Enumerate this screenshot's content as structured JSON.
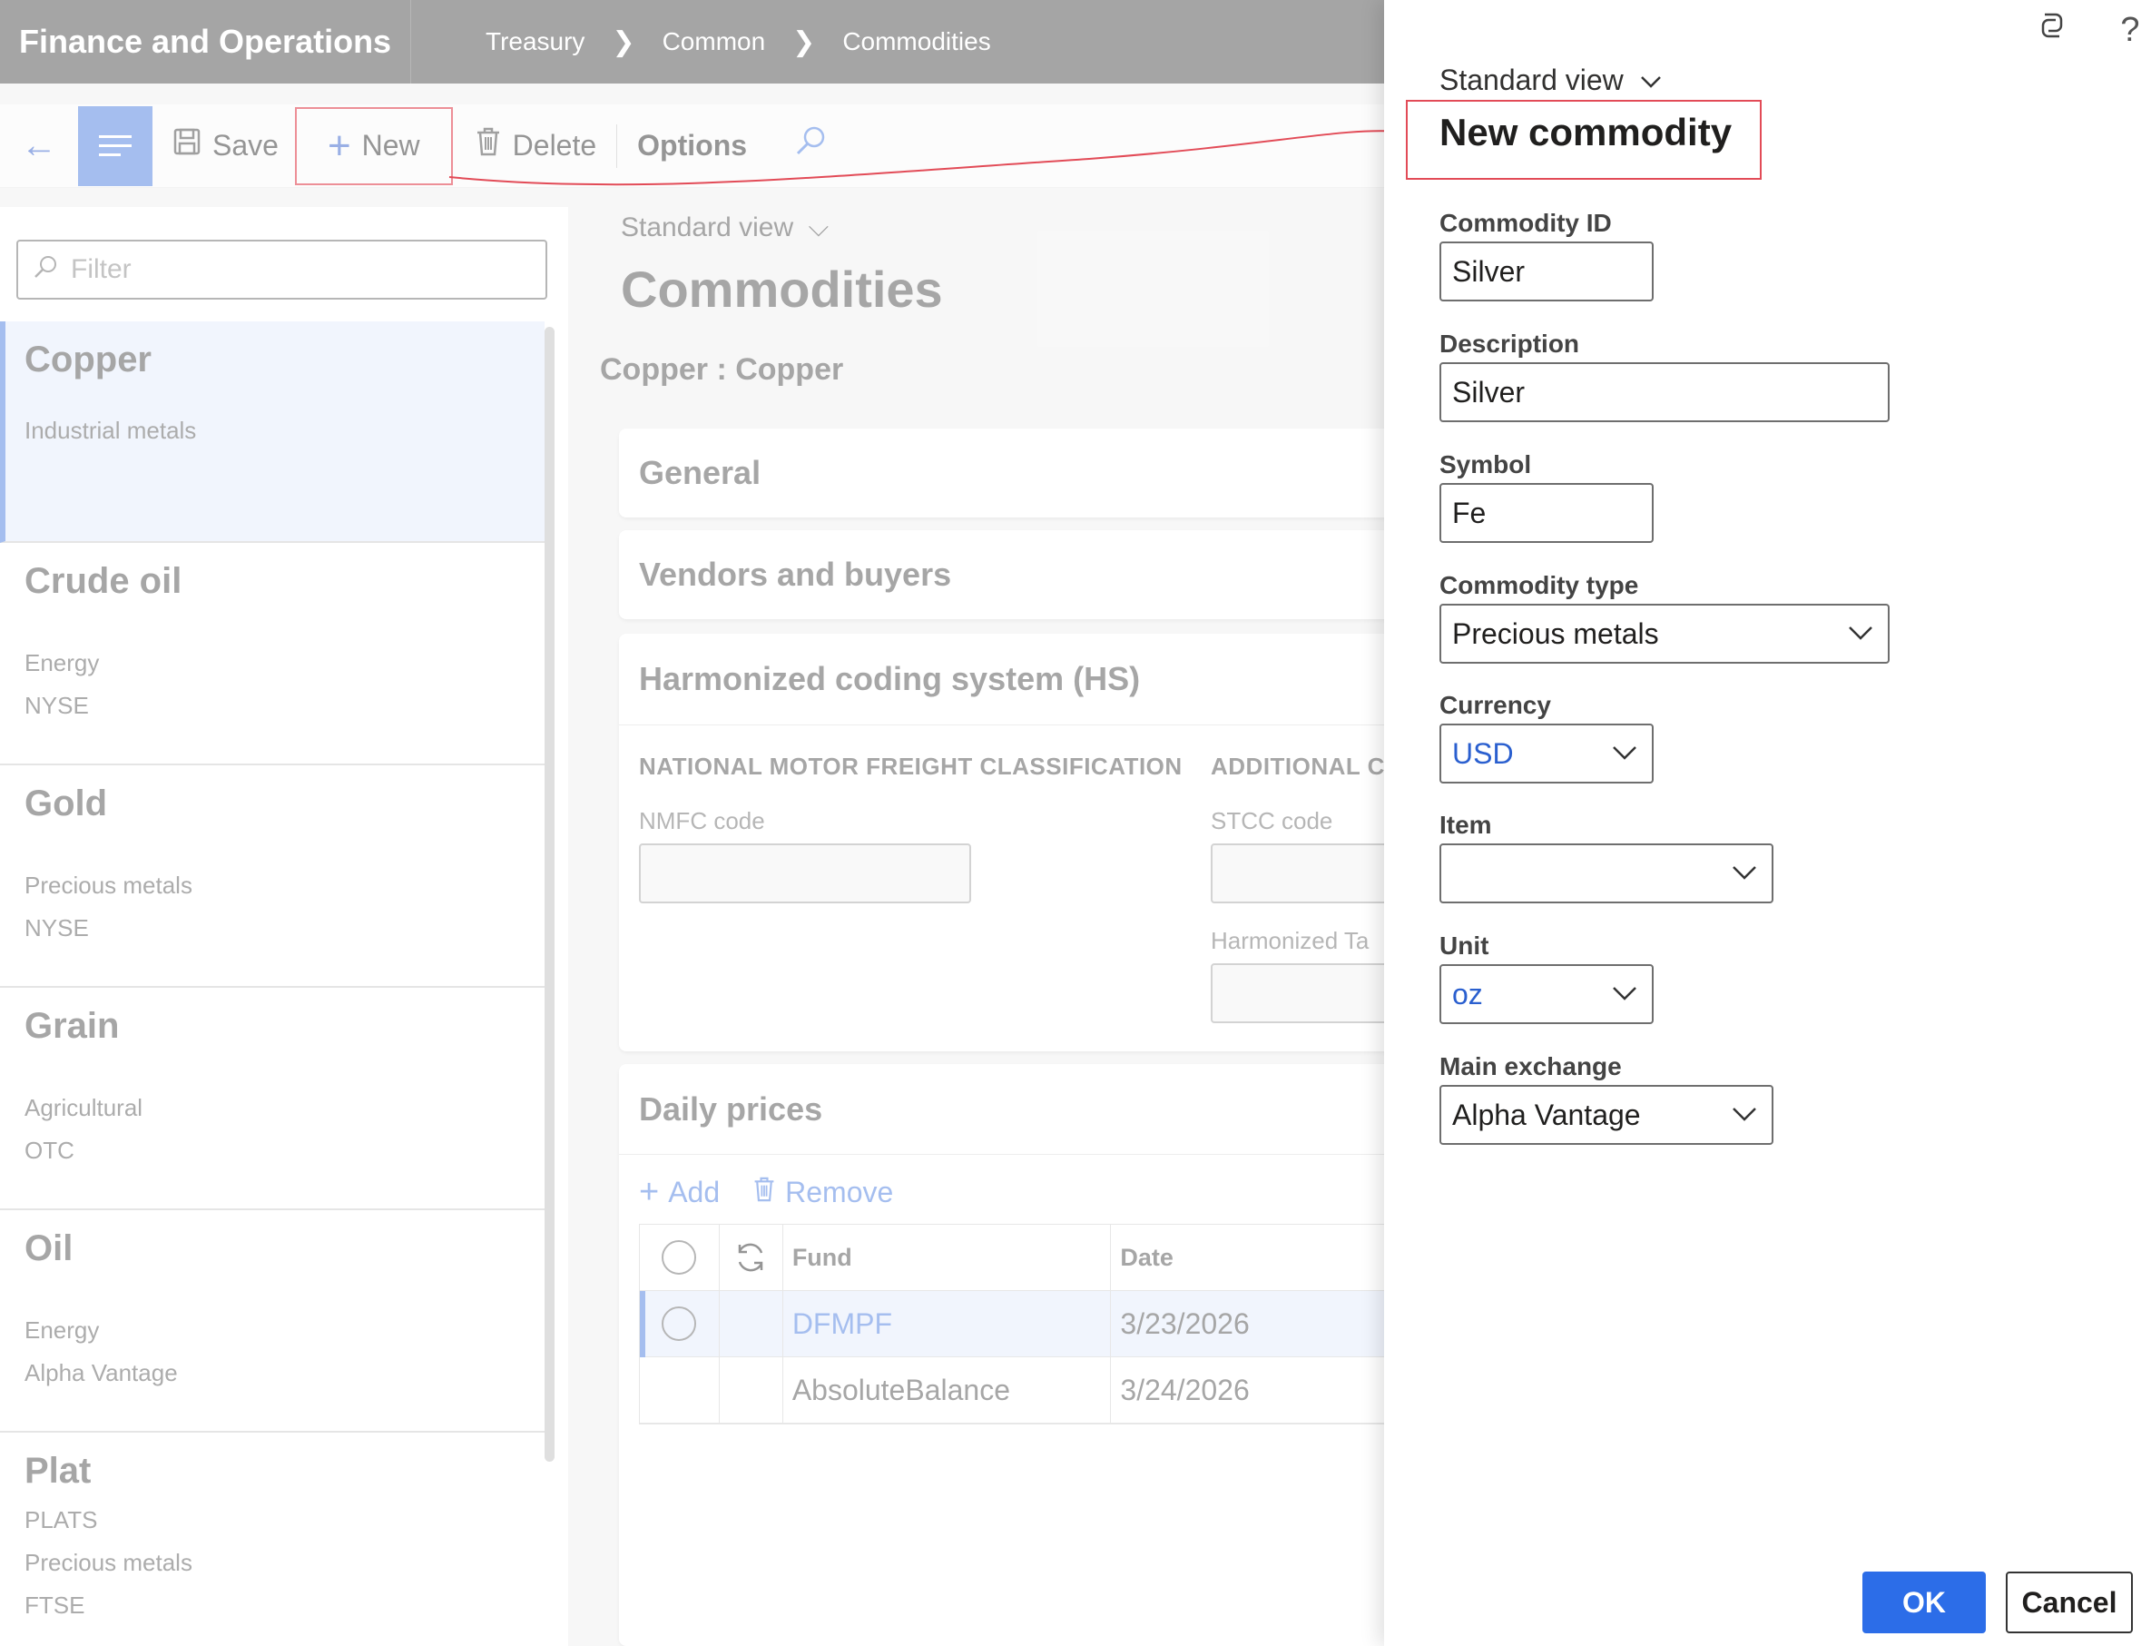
{
  "app": {
    "title": "Finance and Operations",
    "breadcrumbs": [
      "Treasury",
      "Common",
      "Commodities"
    ]
  },
  "toolbar": {
    "save_label": "Save",
    "new_label": "New",
    "delete_label": "Delete",
    "options_label": "Options"
  },
  "list_panel": {
    "filter_placeholder": "Filter",
    "items": [
      {
        "title": "Copper",
        "lines": [
          "Industrial metals"
        ]
      },
      {
        "title": "Crude oil",
        "lines": [
          "Energy",
          "NYSE"
        ]
      },
      {
        "title": "Gold",
        "lines": [
          "Precious metals",
          "NYSE"
        ]
      },
      {
        "title": "Grain",
        "lines": [
          "Agricultural",
          "OTC"
        ]
      },
      {
        "title": "Oil",
        "lines": [
          "Energy",
          "Alpha Vantage"
        ]
      },
      {
        "title": "Plat",
        "lines": [
          "PLATS",
          "Precious metals",
          "FTSE"
        ]
      }
    ]
  },
  "main": {
    "view_label": "Standard view",
    "page_title": "Commodities",
    "record_title": "Copper : Copper",
    "sections": {
      "general": "General",
      "vendors": "Vendors and buyers",
      "hs": "Harmonized coding system (HS)",
      "daily": "Daily prices"
    },
    "hs": {
      "nmfc_heading": "NATIONAL MOTOR FREIGHT CLASSIFICATION",
      "additional_heading": "ADDITIONAL C",
      "nmfc_label": "NMFC code",
      "stcc_label": "STCC code",
      "harmonized_label": "Harmonized Ta"
    },
    "daily_prices": {
      "add_label": "Add",
      "remove_label": "Remove",
      "columns": [
        "Fund",
        "Date"
      ],
      "rows": [
        {
          "fund": "DFMPF",
          "date": "3/23/2026"
        },
        {
          "fund": "AbsoluteBalance",
          "date": "3/24/2026"
        }
      ]
    }
  },
  "dialog": {
    "view_label": "Standard view",
    "title": "New commodity",
    "fields": {
      "commodity_id": {
        "label": "Commodity ID",
        "value": "Silver"
      },
      "description": {
        "label": "Description",
        "value": "Silver"
      },
      "symbol": {
        "label": "Symbol",
        "value": "Fe"
      },
      "commodity_type": {
        "label": "Commodity type",
        "value": "Precious metals"
      },
      "currency": {
        "label": "Currency",
        "value": "USD"
      },
      "item": {
        "label": "Item",
        "value": ""
      },
      "unit": {
        "label": "Unit",
        "value": "oz"
      },
      "main_exchange": {
        "label": "Main exchange",
        "value": "Alpha Vantage"
      }
    },
    "ok_label": "OK",
    "cancel_label": "Cancel"
  },
  "colors": {
    "accent": "#6f97e6",
    "primary_button": "#2c6de8",
    "annotation": "#e24b57",
    "topbar": "#6e6e6e"
  }
}
